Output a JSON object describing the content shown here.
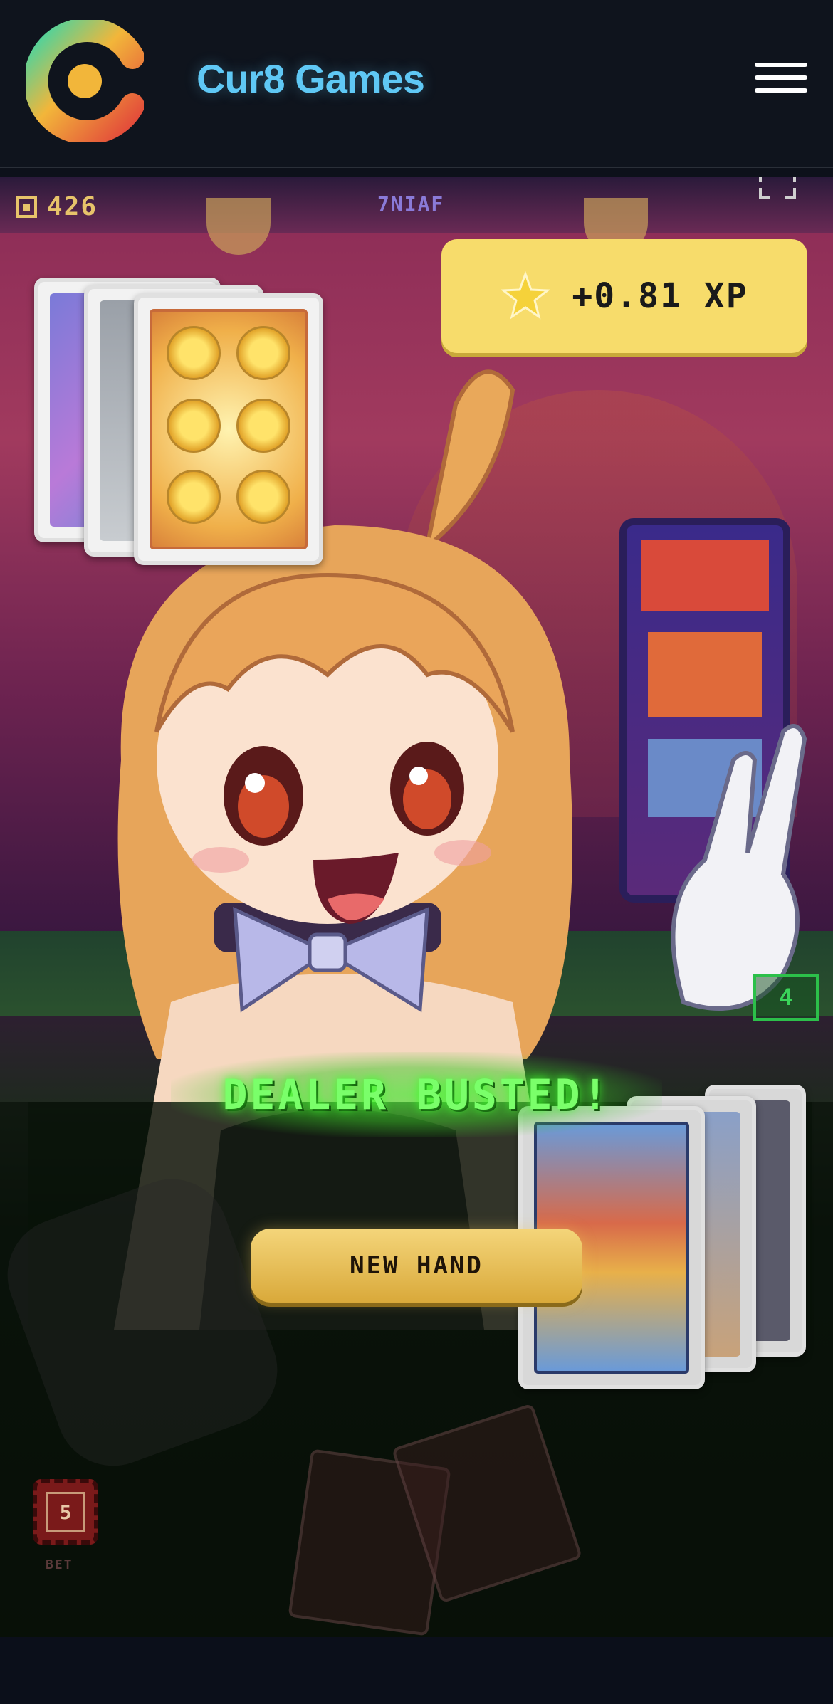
{
  "header": {
    "brand": "Cur8 Games"
  },
  "hud": {
    "coins": "426",
    "round_tag": "7NIAF",
    "xp_reward": "+0.81 XP",
    "dealer_count": "4"
  },
  "result": {
    "message": "DEALER BUSTED!",
    "new_hand_label": "NEW HAND"
  },
  "bet": {
    "chip_value": "5",
    "label": "BET"
  },
  "colors": {
    "brand_text": "#5fc8f5",
    "xp_badge": "#f7dc6b",
    "result_glow": "#7aff6a",
    "button_gold": "#e2b448"
  },
  "icons": {
    "logo": "cur8-logo-icon",
    "menu": "hamburger-menu-icon",
    "coin": "coin-icon",
    "xp": "star-icon",
    "fullscreen": "fullscreen-icon"
  }
}
